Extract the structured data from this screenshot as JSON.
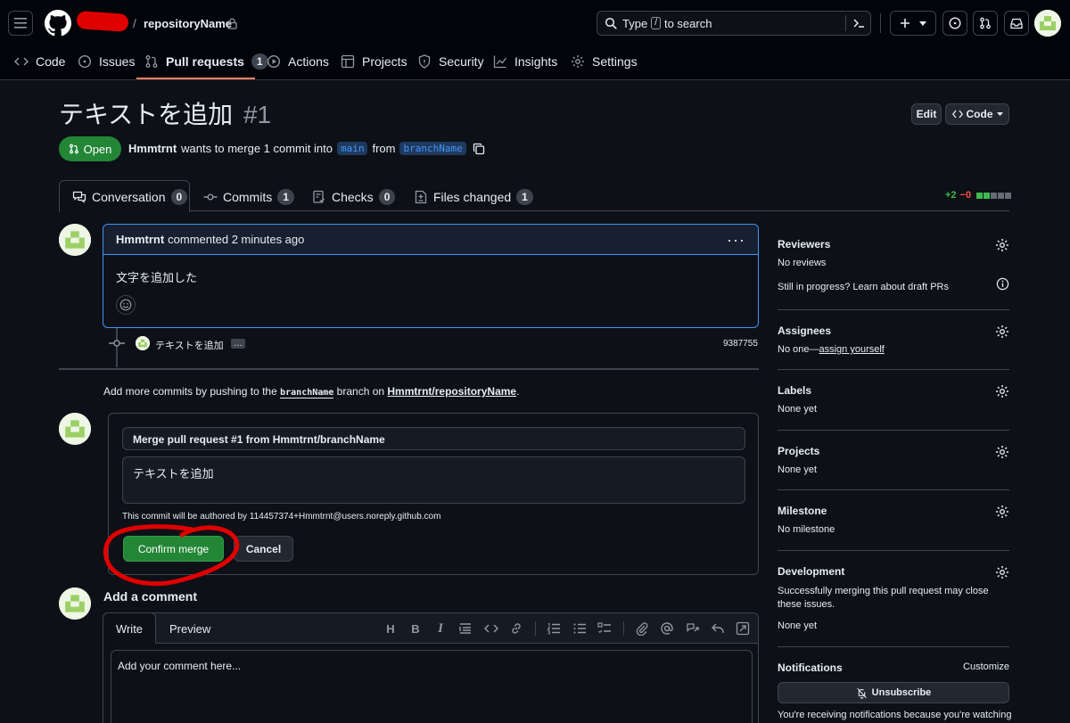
{
  "header": {
    "owner_redacted": "",
    "separator": "/",
    "repo_name": "repositoryName",
    "search_prefix": "Type",
    "search_key": "/",
    "search_suffix": "to search"
  },
  "repo_nav": {
    "code": "Code",
    "issues": "Issues",
    "pull_requests": "Pull requests",
    "pull_requests_count": "1",
    "actions": "Actions",
    "projects": "Projects",
    "security": "Security",
    "insights": "Insights",
    "settings": "Settings"
  },
  "pr": {
    "title": "テキストを追加",
    "number": "#1",
    "state": "Open",
    "author": "Hmmtrnt",
    "merge_text_1": "wants to merge 1 commit into",
    "base_branch": "main",
    "merge_text_2": "from",
    "head_branch": "branchName",
    "edit_label": "Edit",
    "code_label": "Code"
  },
  "tabs": {
    "conversation": "Conversation",
    "conversation_count": "0",
    "commits": "Commits",
    "commits_count": "1",
    "checks": "Checks",
    "checks_count": "0",
    "files_changed": "Files changed",
    "files_count": "1",
    "additions": "+2",
    "deletions": "−0"
  },
  "comment": {
    "author": "Hmmtrnt",
    "meta": "commented 2 minutes ago",
    "body": "文字を追加した"
  },
  "commit_event": {
    "message": "テキストを追加",
    "ellipsis": "…",
    "sha": "9387755"
  },
  "push_hint": {
    "prefix": "Add more commits by pushing to the",
    "branch": "branchName",
    "middle": "branch on",
    "repo": "Hmmtrnt/repositoryName",
    "suffix": "."
  },
  "merge_form": {
    "title_value": "Merge pull request #1 from Hmmtrnt/branchName",
    "body_value": "テキストを追加",
    "author_note": "This commit will be authored by 114457374+Hmmtrnt@users.noreply.github.com",
    "confirm_label": "Confirm merge",
    "cancel_label": "Cancel"
  },
  "new_comment": {
    "heading": "Add a comment",
    "write_tab": "Write",
    "preview_tab": "Preview",
    "placeholder": "Add your comment here..."
  },
  "sidebar": {
    "reviewers_title": "Reviewers",
    "reviewers_value": "No reviews",
    "reviewers_hint": "Still in progress? Learn about draft PRs",
    "assignees_title": "Assignees",
    "assignees_prefix": "No one—",
    "assignees_link": "assign yourself",
    "labels_title": "Labels",
    "labels_value": "None yet",
    "projects_title": "Projects",
    "projects_value": "None yet",
    "milestone_title": "Milestone",
    "milestone_value": "No milestone",
    "development_title": "Development",
    "development_text": "Successfully merging this pull request may close these issues.",
    "development_value": "None yet",
    "notifications_title": "Notifications",
    "customize_label": "Customize",
    "unsubscribe_label": "Unsubscribe",
    "notifications_text": "You're receiving notifications because you're watching"
  },
  "colors": {
    "accent_blue": "#4493f8",
    "success_green": "#238636",
    "annotation_red": "#e00000"
  }
}
